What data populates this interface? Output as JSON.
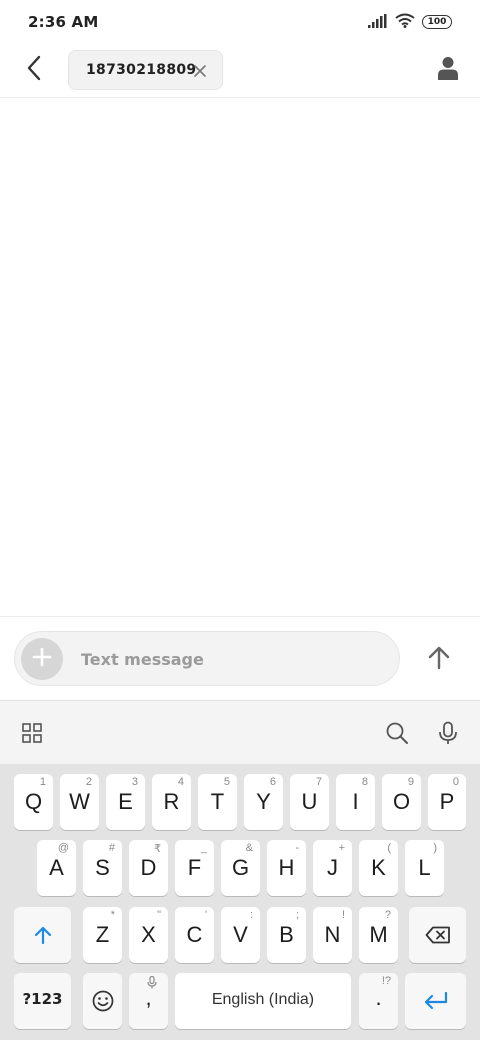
{
  "status_bar": {
    "time": "2:36 AM",
    "battery": "100",
    "icons": [
      "signal-icon",
      "wifi-icon",
      "battery-icon"
    ]
  },
  "header": {
    "back_icon": "back-arrow-icon",
    "recipient": "18730218809",
    "remove_icon": "close-icon",
    "contact_icon": "contact-person-icon"
  },
  "composer": {
    "placeholder": "Text message",
    "attach_icon": "plus-icon",
    "send_icon": "send-arrow-icon"
  },
  "keyboard_toolbar": {
    "icons": [
      "grid-menu-icon",
      "search-icon",
      "microphone-icon"
    ]
  },
  "keyboard": {
    "row1": [
      {
        "key": "Q",
        "sub": "1"
      },
      {
        "key": "W",
        "sub": "2"
      },
      {
        "key": "E",
        "sub": "3"
      },
      {
        "key": "R",
        "sub": "4"
      },
      {
        "key": "T",
        "sub": "5"
      },
      {
        "key": "Y",
        "sub": "6"
      },
      {
        "key": "U",
        "sub": "7"
      },
      {
        "key": "I",
        "sub": "8"
      },
      {
        "key": "O",
        "sub": "9"
      },
      {
        "key": "P",
        "sub": "0"
      }
    ],
    "row2": [
      {
        "key": "A",
        "sub": "@"
      },
      {
        "key": "S",
        "sub": "#"
      },
      {
        "key": "D",
        "sub": "₹"
      },
      {
        "key": "F",
        "sub": "_"
      },
      {
        "key": "G",
        "sub": "&"
      },
      {
        "key": "H",
        "sub": "-"
      },
      {
        "key": "J",
        "sub": "+"
      },
      {
        "key": "K",
        "sub": "("
      },
      {
        "key": "L",
        "sub": ")"
      }
    ],
    "row3": [
      {
        "key": "Z",
        "sub": "*"
      },
      {
        "key": "X",
        "sub": "\""
      },
      {
        "key": "C",
        "sub": "'"
      },
      {
        "key": "V",
        "sub": ":"
      },
      {
        "key": "B",
        "sub": ";"
      },
      {
        "key": "N",
        "sub": "!"
      },
      {
        "key": "M",
        "sub": "?"
      }
    ],
    "numbers_key": "?123",
    "comma_key": ",",
    "space_label": "English (India)",
    "period_key": ".",
    "period_sub": "!?",
    "icons": [
      "shift-arrow-icon",
      "backspace-icon",
      "emoji-icon",
      "enter-icon"
    ],
    "accent_color": "#1e88e5"
  }
}
